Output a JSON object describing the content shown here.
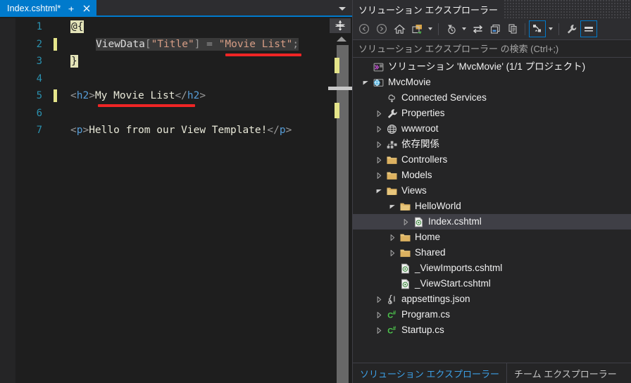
{
  "editor": {
    "tab": {
      "title": "Index.cshtml*",
      "pin_icon": "pin-icon",
      "close_icon": "close-icon"
    },
    "overflow_icon": "chevron-down-icon",
    "lines": [
      {
        "num": "1",
        "changed": false
      },
      {
        "num": "2",
        "changed": true
      },
      {
        "num": "3",
        "changed": false
      },
      {
        "num": "4",
        "changed": false
      },
      {
        "num": "5",
        "changed": true
      },
      {
        "num": "6",
        "changed": false
      },
      {
        "num": "7",
        "changed": false
      }
    ],
    "code": {
      "line1_razor_open": "@{",
      "line2_ident": "ViewData",
      "line2_bracket_open": "[",
      "line2_key": "\"Title\"",
      "line2_bracket_close": "]",
      "line2_equals": " = ",
      "line2_value": "\"Movie List\"",
      "line2_semicolon": ";",
      "line3_razor_close": "}",
      "line5_open_lt": "<",
      "line5_tag_open": "h2",
      "line5_open_gt": ">",
      "line5_content": "My Movie List",
      "line5_close_lt": "</",
      "line5_tag_close": "h2",
      "line5_close_gt": ">",
      "line7_open_lt": "<",
      "line7_tag_open": "p",
      "line7_open_gt": ">",
      "line7_content": "Hello from our View Template!",
      "line7_close_lt": "</",
      "line7_tag_close": "p",
      "line7_close_gt": ">"
    },
    "scrollbar": {
      "splitter_icon": "split-view-icon",
      "up_icon": "scroll-up-arrow-icon"
    },
    "colors": {
      "tab_active_bg": "#007acc",
      "editor_bg": "#1e1e1e",
      "line_number": "#2b91af",
      "tag": "#569cd6",
      "string": "#d69d85",
      "punct": "#9a9a9a",
      "change_bar": "#e5e58a",
      "annotation_red": "#ef2525",
      "razor_brace_bg": "#e3e3b8"
    }
  },
  "solution_explorer": {
    "title": "ソリューション エクスプローラー",
    "search_placeholder": "ソリューション エクスプローラー の検索 (Ctrl+;)",
    "search_value": "",
    "toolbar": [
      {
        "name": "back-button",
        "icon": "back-arrow-icon"
      },
      {
        "name": "forward-button",
        "icon": "forward-arrow-icon"
      },
      {
        "name": "home-button",
        "icon": "home-icon"
      },
      {
        "name": "add-new-item-button",
        "icon": "new-item-folder-icon"
      },
      {
        "name": "pending-changes-filter-button",
        "icon": "clock-filter-icon"
      },
      {
        "name": "sync-with-active-document-button",
        "icon": "sync-arrows-icon"
      },
      {
        "name": "refresh-button",
        "icon": "refresh-windows-icon"
      },
      {
        "name": "show-all-files-button",
        "icon": "show-all-files-icon"
      },
      {
        "name": "collapse-all-button",
        "icon": "collapse-all-icon"
      },
      {
        "name": "properties-button",
        "icon": "wrench-icon"
      },
      {
        "name": "preview-selected-items-button",
        "icon": "preview-pane-icon"
      }
    ],
    "tree": [
      {
        "label": "ソリューション 'MvcMovie' (1/1 プロジェクト)",
        "icon": "solution-icon",
        "indent": 0,
        "twisty": "none",
        "selected": false
      },
      {
        "label": "MvcMovie",
        "icon": "web-project-icon",
        "indent": 0,
        "twisty": "expanded",
        "selected": false
      },
      {
        "label": "Connected Services",
        "icon": "connected-services-icon",
        "indent": 1,
        "twisty": "none",
        "selected": false
      },
      {
        "label": "Properties",
        "icon": "wrench-icon",
        "indent": 1,
        "twisty": "collapsed",
        "selected": false
      },
      {
        "label": "wwwroot",
        "icon": "globe-icon",
        "indent": 1,
        "twisty": "collapsed",
        "selected": false
      },
      {
        "label": "依存関係",
        "icon": "dependencies-icon",
        "indent": 1,
        "twisty": "collapsed",
        "selected": false
      },
      {
        "label": "Controllers",
        "icon": "folder-icon",
        "indent": 1,
        "twisty": "collapsed",
        "selected": false
      },
      {
        "label": "Models",
        "icon": "folder-icon",
        "indent": 1,
        "twisty": "collapsed",
        "selected": false
      },
      {
        "label": "Views",
        "icon": "folder-open-icon",
        "indent": 1,
        "twisty": "expanded",
        "selected": false
      },
      {
        "label": "HelloWorld",
        "icon": "folder-open-icon",
        "indent": 2,
        "twisty": "expanded",
        "selected": false
      },
      {
        "label": "Index.cshtml",
        "icon": "razor-file-icon",
        "indent": 3,
        "twisty": "collapsed",
        "selected": true
      },
      {
        "label": "Home",
        "icon": "folder-icon",
        "indent": 2,
        "twisty": "collapsed",
        "selected": false
      },
      {
        "label": "Shared",
        "icon": "folder-icon",
        "indent": 2,
        "twisty": "collapsed",
        "selected": false
      },
      {
        "label": "_ViewImports.cshtml",
        "icon": "razor-file-icon",
        "indent": 2,
        "twisty": "none",
        "selected": false
      },
      {
        "label": "_ViewStart.cshtml",
        "icon": "razor-file-icon",
        "indent": 2,
        "twisty": "none",
        "selected": false
      },
      {
        "label": "appsettings.json",
        "icon": "json-file-icon",
        "indent": 1,
        "twisty": "collapsed",
        "selected": false
      },
      {
        "label": "Program.cs",
        "icon": "csharp-file-icon",
        "indent": 1,
        "twisty": "collapsed",
        "selected": false
      },
      {
        "label": "Startup.cs",
        "icon": "csharp-file-icon",
        "indent": 1,
        "twisty": "collapsed",
        "selected": false
      }
    ],
    "bottom_tabs": [
      {
        "label": "ソリューション エクスプローラー",
        "active": true
      },
      {
        "label": "チーム エクスプローラー",
        "active": false
      }
    ]
  }
}
